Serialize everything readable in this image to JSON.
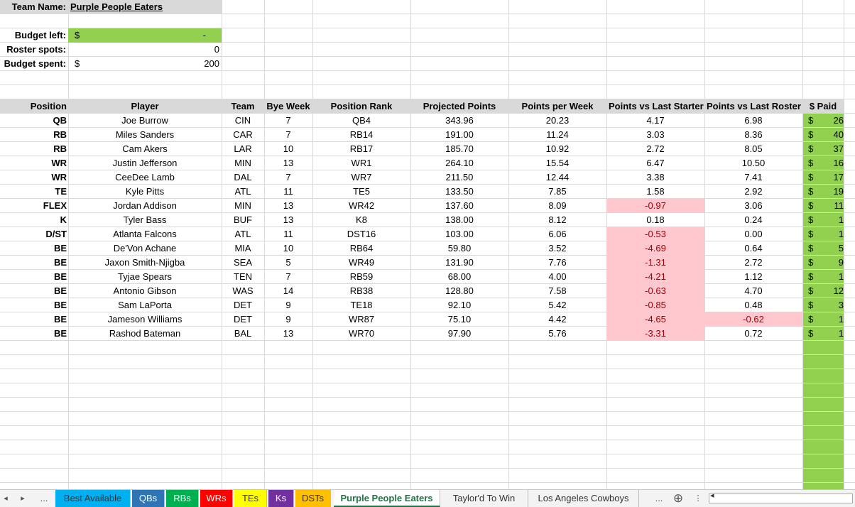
{
  "team_info": {
    "team_name_label": "Team Name:",
    "team_name": "Purple People Eaters",
    "budget_left_label": "Budget left:",
    "budget_left_currency": "$",
    "budget_left_value": "-",
    "roster_spots_label": "Roster spots:",
    "roster_spots_value": "0",
    "budget_spent_label": "Budget spent:",
    "budget_spent_currency": "$",
    "budget_spent_value": "200"
  },
  "table": {
    "headers": [
      "Position",
      "Player",
      "Team",
      "Bye Week",
      "Position Rank",
      "Projected Points",
      "Points per Week",
      "Points vs Last Starter",
      "Points vs Last Roster",
      "$ Paid"
    ],
    "currency": "$",
    "rows": [
      {
        "position": "QB",
        "player": "Joe Burrow",
        "team": "CIN",
        "bye": "7",
        "rank": "QB4",
        "projected": "343.96",
        "ppw": "20.23",
        "vs_starter": "4.17",
        "vs_roster": "6.98",
        "paid": "26"
      },
      {
        "position": "RB",
        "player": "Miles Sanders",
        "team": "CAR",
        "bye": "7",
        "rank": "RB14",
        "projected": "191.00",
        "ppw": "11.24",
        "vs_starter": "3.03",
        "vs_roster": "8.36",
        "paid": "40"
      },
      {
        "position": "RB",
        "player": "Cam Akers",
        "team": "LAR",
        "bye": "10",
        "rank": "RB17",
        "projected": "185.70",
        "ppw": "10.92",
        "vs_starter": "2.72",
        "vs_roster": "8.05",
        "paid": "37"
      },
      {
        "position": "WR",
        "player": "Justin Jefferson",
        "team": "MIN",
        "bye": "13",
        "rank": "WR1",
        "projected": "264.10",
        "ppw": "15.54",
        "vs_starter": "6.47",
        "vs_roster": "10.50",
        "paid": "16"
      },
      {
        "position": "WR",
        "player": "CeeDee Lamb",
        "team": "DAL",
        "bye": "7",
        "rank": "WR7",
        "projected": "211.50",
        "ppw": "12.44",
        "vs_starter": "3.38",
        "vs_roster": "7.41",
        "paid": "17"
      },
      {
        "position": "TE",
        "player": "Kyle Pitts",
        "team": "ATL",
        "bye": "11",
        "rank": "TE5",
        "projected": "133.50",
        "ppw": "7.85",
        "vs_starter": "1.58",
        "vs_roster": "2.92",
        "paid": "19"
      },
      {
        "position": "FLEX",
        "player": "Jordan Addison",
        "team": "MIN",
        "bye": "13",
        "rank": "WR42",
        "projected": "137.60",
        "ppw": "8.09",
        "vs_starter": "-0.97",
        "vs_roster": "3.06",
        "paid": "11"
      },
      {
        "position": "K",
        "player": "Tyler Bass",
        "team": "BUF",
        "bye": "13",
        "rank": "K8",
        "projected": "138.00",
        "ppw": "8.12",
        "vs_starter": "0.18",
        "vs_roster": "0.24",
        "paid": "1"
      },
      {
        "position": "D/ST",
        "player": "Atlanta Falcons",
        "team": "ATL",
        "bye": "11",
        "rank": "DST16",
        "projected": "103.00",
        "ppw": "6.06",
        "vs_starter": "-0.53",
        "vs_roster": "0.00",
        "paid": "1"
      },
      {
        "position": "BE",
        "player": "De'Von Achane",
        "team": "MIA",
        "bye": "10",
        "rank": "RB64",
        "projected": "59.80",
        "ppw": "3.52",
        "vs_starter": "-4.69",
        "vs_roster": "0.64",
        "paid": "5"
      },
      {
        "position": "BE",
        "player": "Jaxon Smith-Njigba",
        "team": "SEA",
        "bye": "5",
        "rank": "WR49",
        "projected": "131.90",
        "ppw": "7.76",
        "vs_starter": "-1.31",
        "vs_roster": "2.72",
        "paid": "9"
      },
      {
        "position": "BE",
        "player": "Tyjae Spears",
        "team": "TEN",
        "bye": "7",
        "rank": "RB59",
        "projected": "68.00",
        "ppw": "4.00",
        "vs_starter": "-4.21",
        "vs_roster": "1.12",
        "paid": "1"
      },
      {
        "position": "BE",
        "player": "Antonio Gibson",
        "team": "WAS",
        "bye": "14",
        "rank": "RB38",
        "projected": "128.80",
        "ppw": "7.58",
        "vs_starter": "-0.63",
        "vs_roster": "4.70",
        "paid": "12"
      },
      {
        "position": "BE",
        "player": "Sam LaPorta",
        "team": "DET",
        "bye": "9",
        "rank": "TE18",
        "projected": "92.10",
        "ppw": "5.42",
        "vs_starter": "-0.85",
        "vs_roster": "0.48",
        "paid": "3"
      },
      {
        "position": "BE",
        "player": "Jameson Williams",
        "team": "DET",
        "bye": "9",
        "rank": "WR87",
        "projected": "75.10",
        "ppw": "4.42",
        "vs_starter": "-4.65",
        "vs_roster": "-0.62",
        "paid": "1"
      },
      {
        "position": "BE",
        "player": "Rashod Bateman",
        "team": "BAL",
        "bye": "13",
        "rank": "WR70",
        "projected": "97.90",
        "ppw": "5.76",
        "vs_starter": "-3.31",
        "vs_roster": "0.72",
        "paid": "1"
      }
    ]
  },
  "colors": {
    "green_fill": "#92d050",
    "header_gray": "#d9d9d9",
    "negative_fill": "#ffc7ce",
    "negative_text": "#9c0006",
    "tab_blue": "#00b0f0",
    "tab_navy": "#2f75b5",
    "tab_green": "#00b050",
    "tab_red": "#ff0000",
    "tab_yellow": "#ffff00",
    "tab_purple": "#7030a0",
    "tab_orange": "#ffc000",
    "active_tab_text": "#217346"
  },
  "tabs": [
    {
      "label": "Best Available",
      "color": "#00b0f0"
    },
    {
      "label": "QBs",
      "color": "#2f75b5"
    },
    {
      "label": "RBs",
      "color": "#00b050"
    },
    {
      "label": "WRs",
      "color": "#ff0000"
    },
    {
      "label": "TEs",
      "color": "#ffff00"
    },
    {
      "label": "Ks",
      "color": "#7030a0"
    },
    {
      "label": "DSTs",
      "color": "#ffc000"
    },
    {
      "label": "Purple People Eaters",
      "active": true
    },
    {
      "label": "Taylor'd To Win"
    },
    {
      "label": "Los Angeles Cowboys"
    }
  ],
  "tabbar": {
    "prev_icon": "◂",
    "next_icon": "▸",
    "ellipsis_left": "...",
    "ellipsis_right": "...",
    "add_sheet_icon": "⊕",
    "more_icon": "⋮",
    "scroll_left_icon": "◂"
  }
}
